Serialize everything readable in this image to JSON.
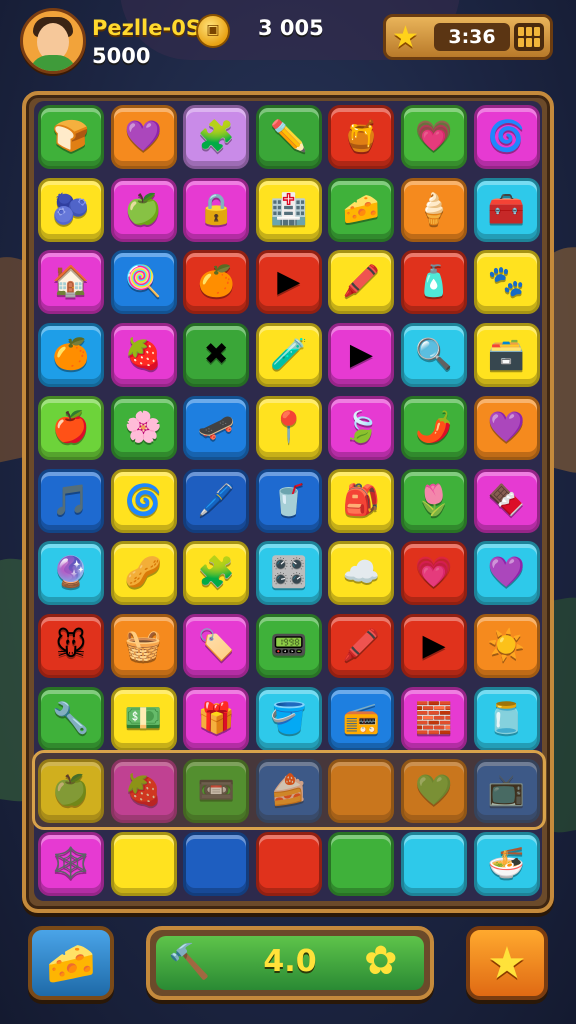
{
  "hud": {
    "player_name": "Pezlle-0S",
    "player_score": "5000",
    "coin_count": "3 005",
    "timer": "3:36",
    "avatar_icon": "player-avatar",
    "coin_icon": "coin-icon",
    "star_icon": "star-icon",
    "menu_icon": "grid-menu-icon"
  },
  "board": {
    "columns": 7,
    "rows": [
      [
        {
          "color": "#3fb13a",
          "glyph": "🍞",
          "icon": "bread-icon"
        },
        {
          "color": "#f58a1e",
          "glyph": "💜",
          "icon": "purple-heart-icon"
        },
        {
          "color": "#c98be8",
          "glyph": "🧩",
          "icon": "puzzle-icon"
        },
        {
          "color": "#3aa638",
          "glyph": "✏️",
          "icon": "pencil-icon"
        },
        {
          "color": "#e0321c",
          "glyph": "🍯",
          "icon": "honey-pot-icon"
        },
        {
          "color": "#47b83a",
          "glyph": "💗",
          "icon": "pink-heart-icon"
        },
        {
          "color": "#e63ad2",
          "glyph": "🌀",
          "icon": "swirl-icon"
        }
      ],
      [
        {
          "color": "#ffe21f",
          "glyph": "🫐",
          "icon": "blue-apple-icon"
        },
        {
          "color": "#e63ad2",
          "glyph": "🍏",
          "icon": "green-apple-icon"
        },
        {
          "color": "#e63ad2",
          "glyph": "🔒",
          "icon": "lock-icon"
        },
        {
          "color": "#ffe21f",
          "glyph": "🏥",
          "icon": "house-icon"
        },
        {
          "color": "#3fb13a",
          "glyph": "🧀",
          "icon": "cheese-icon"
        },
        {
          "color": "#f58a1e",
          "glyph": "🍦",
          "icon": "ice-cream-icon"
        },
        {
          "color": "#2ec9ea",
          "glyph": "🧰",
          "icon": "toolbox-icon"
        }
      ],
      [
        {
          "color": "#e63ad2",
          "glyph": "🏠",
          "icon": "home-icon"
        },
        {
          "color": "#1e7fe0",
          "glyph": "🍭",
          "icon": "lollipop-icon"
        },
        {
          "color": "#e0321c",
          "glyph": "🍊",
          "icon": "orange-ball-icon"
        },
        {
          "color": "#e0321c",
          "glyph": "▶",
          "icon": "play-triangle-icon"
        },
        {
          "color": "#ffe21f",
          "glyph": "🖍️",
          "icon": "crayon-icon"
        },
        {
          "color": "#e0321c",
          "glyph": "🧴",
          "icon": "jar-icon"
        },
        {
          "color": "#ffe21f",
          "glyph": "🐾",
          "icon": "paw-blob-icon"
        }
      ],
      [
        {
          "color": "#1e9ee8",
          "glyph": "🍊",
          "icon": "orange-icon"
        },
        {
          "color": "#e63ad2",
          "glyph": "🍓",
          "icon": "strawberry-icon"
        },
        {
          "color": "#3aa638",
          "glyph": "✖",
          "icon": "cross-icon"
        },
        {
          "color": "#ffe21f",
          "glyph": "🧪",
          "icon": "test-tube-icon"
        },
        {
          "color": "#e63ad2",
          "glyph": "▶",
          "icon": "play-yellow-icon"
        },
        {
          "color": "#2ec9ea",
          "glyph": "🔍",
          "icon": "magnifier-icon"
        },
        {
          "color": "#ffe21f",
          "glyph": "🗃️",
          "icon": "box-icon"
        }
      ],
      [
        {
          "color": "#6dd33a",
          "glyph": "🍎",
          "icon": "red-apple-icon"
        },
        {
          "color": "#3fb13a",
          "glyph": "🌸",
          "icon": "flower-blob-icon"
        },
        {
          "color": "#1e7fe0",
          "glyph": "🛹",
          "icon": "skate-icon"
        },
        {
          "color": "#ffe21f",
          "glyph": "📍",
          "icon": "pin-icon"
        },
        {
          "color": "#e63ad2",
          "glyph": "🍃",
          "icon": "leaf-icon"
        },
        {
          "color": "#3fb13a",
          "glyph": "🌶️",
          "icon": "chili-icon"
        },
        {
          "color": "#f58a1e",
          "glyph": "💜",
          "icon": "purple-leaf-icon"
        }
      ],
      [
        {
          "color": "#1e6ad0",
          "glyph": "🎵",
          "icon": "music-note-icon"
        },
        {
          "color": "#ffe21f",
          "glyph": "🌀",
          "icon": "spiral-candy-icon"
        },
        {
          "color": "#1e5ec0",
          "glyph": "🖊️",
          "icon": "marker-icon"
        },
        {
          "color": "#1e6ad0",
          "glyph": "🥤",
          "icon": "cup-icon"
        },
        {
          "color": "#ffe21f",
          "glyph": "🎒",
          "icon": "bag-icon"
        },
        {
          "color": "#3fb13a",
          "glyph": "🌷",
          "icon": "tulip-icon"
        },
        {
          "color": "#e63ad2",
          "glyph": "🍫",
          "icon": "candy-bar-icon"
        }
      ],
      [
        {
          "color": "#2ec9ea",
          "glyph": "🔮",
          "icon": "purple-orb-icon"
        },
        {
          "color": "#ffe21f",
          "glyph": "🥜",
          "icon": "peanut-icon"
        },
        {
          "color": "#ffe21f",
          "glyph": "🧩",
          "icon": "blue-puzzle-icon"
        },
        {
          "color": "#2ec9ea",
          "glyph": "🎛️",
          "icon": "radio-icon"
        },
        {
          "color": "#ffe21f",
          "glyph": "☁️",
          "icon": "cloud-icon"
        },
        {
          "color": "#e0321c",
          "glyph": "💗",
          "icon": "heart-icon"
        },
        {
          "color": "#2ec9ea",
          "glyph": "💜",
          "icon": "violet-heart-icon"
        }
      ],
      [
        {
          "color": "#e0321c",
          "glyph": "🐭",
          "icon": "mouse-icon"
        },
        {
          "color": "#f58a1e",
          "glyph": "🧺",
          "icon": "tray-icon"
        },
        {
          "color": "#e63ad2",
          "glyph": "🏷️",
          "icon": "tag-icon"
        },
        {
          "color": "#3fb13a",
          "glyph": "📟",
          "icon": "pager-icon"
        },
        {
          "color": "#e0321c",
          "glyph": "🖍️",
          "icon": "pink-crayon-icon"
        },
        {
          "color": "#e0321c",
          "glyph": "▶",
          "icon": "green-play-icon"
        },
        {
          "color": "#f58a1e",
          "glyph": "☀️",
          "icon": "sun-icon"
        }
      ],
      [
        {
          "color": "#3fb13a",
          "glyph": "🔧",
          "icon": "wrench-icon"
        },
        {
          "color": "#ffe21f",
          "glyph": "💵",
          "icon": "cash-icon"
        },
        {
          "color": "#e63ad2",
          "glyph": "🎁",
          "icon": "gift-box-icon"
        },
        {
          "color": "#2ec9ea",
          "glyph": "🪣",
          "icon": "bucket-icon"
        },
        {
          "color": "#1e7fe0",
          "glyph": "📻",
          "icon": "boombox-icon"
        },
        {
          "color": "#e63ad2",
          "glyph": "🧱",
          "icon": "brick-icon"
        },
        {
          "color": "#2ec9ea",
          "glyph": "🫙",
          "icon": "bottle-icon"
        }
      ],
      [
        {
          "color": "#ffe21f",
          "glyph": "🍏",
          "icon": "green-apple-icon"
        },
        {
          "color": "#e63ad2",
          "glyph": "🍓",
          "icon": "tomato-icon"
        },
        {
          "color": "#3fb13a",
          "glyph": "📼",
          "icon": "cassette-icon"
        },
        {
          "color": "#1e5ec0",
          "glyph": "🍰",
          "icon": "cake-slice-icon"
        },
        {
          "color": "#f58a1e",
          "glyph": "",
          "icon": "empty-tile"
        },
        {
          "color": "#f58a1e",
          "glyph": "💚",
          "icon": "green-gem-icon"
        },
        {
          "color": "#1e5ec0",
          "glyph": "📺",
          "icon": "tv-icon"
        }
      ],
      [
        {
          "color": "#e63ad2",
          "glyph": "🕸️",
          "icon": "web-ball-icon"
        },
        {
          "color": "#ffe21f",
          "glyph": "",
          "icon": "empty-tile"
        },
        {
          "color": "#1e5ec0",
          "glyph": "",
          "icon": "empty-tile"
        },
        {
          "color": "#e0321c",
          "glyph": "",
          "icon": "empty-tile"
        },
        {
          "color": "#3fb13a",
          "glyph": "",
          "icon": "empty-tile"
        },
        {
          "color": "#2ec9ea",
          "glyph": "",
          "icon": "empty-tile"
        },
        {
          "color": "#2ec9ea",
          "glyph": "🍜",
          "icon": "bowl-icon"
        }
      ]
    ]
  },
  "bottom": {
    "left_button_icon": "cheese-booster-icon",
    "tool_icon": "hammer-icon",
    "moves": "4.0",
    "flower_icon": "flower-icon",
    "right_button_icon": "star-icon",
    "progress": 1.0
  },
  "colors": {
    "frame": "#c48a3c",
    "frame_dark": "#6b4a2a",
    "accent_yellow": "#ffd92e",
    "progress_green": "#3fb13a"
  }
}
